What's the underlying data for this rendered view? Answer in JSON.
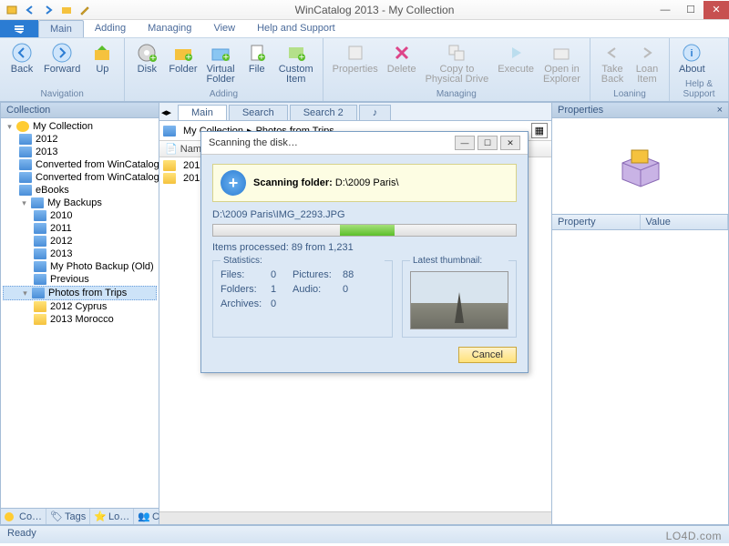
{
  "window": {
    "title": "WinCatalog 2013 - My Collection"
  },
  "tabs": {
    "main": "Main",
    "adding": "Adding",
    "managing": "Managing",
    "view": "View",
    "help": "Help and Support"
  },
  "ribbon": {
    "nav": {
      "back": "Back",
      "forward": "Forward",
      "up": "Up",
      "label": "Navigation"
    },
    "adding": {
      "disk": "Disk",
      "folder": "Folder",
      "virtual": "Virtual\nFolder",
      "file": "File",
      "custom": "Custom\nItem",
      "label": "Adding"
    },
    "managing": {
      "properties": "Properties",
      "delete": "Delete",
      "copy": "Copy to\nPhysical Drive",
      "execute": "Execute",
      "open": "Open in\nExplorer",
      "label": "Managing"
    },
    "loaning": {
      "take": "Take\nBack",
      "loan": "Loan\nItem",
      "label": "Loaning"
    },
    "helpg": {
      "about": "About",
      "label": "Help & Support"
    }
  },
  "sidebar": {
    "header": "Collection",
    "items": [
      {
        "label": "My Collection"
      },
      {
        "label": "2012"
      },
      {
        "label": "2013"
      },
      {
        "label": "Converted from WinCatalog"
      },
      {
        "label": "Converted from WinCatalog"
      },
      {
        "label": "eBooks"
      },
      {
        "label": "My Backups"
      },
      {
        "label": "2010"
      },
      {
        "label": "2011"
      },
      {
        "label": "2012"
      },
      {
        "label": "2013"
      },
      {
        "label": "My Photo Backup (Old)"
      },
      {
        "label": "Previous"
      },
      {
        "label": "Photos from Trips"
      },
      {
        "label": "2012 Cyprus"
      },
      {
        "label": "2013 Morocco"
      }
    ],
    "bottom_tabs": {
      "co1": "Co…",
      "tags": "Tags",
      "lo": "Lo…",
      "co2": "Co…"
    }
  },
  "center": {
    "tabs": {
      "main": "Main",
      "search": "Search",
      "search2": "Search 2"
    },
    "breadcrumb": {
      "a": "My Collection",
      "sep": "▸",
      "b": "Photos from Trips"
    },
    "col_name": "Name",
    "rows": [
      {
        "label": "2012"
      },
      {
        "label": "2013"
      }
    ]
  },
  "right": {
    "header": "Properties",
    "col_property": "Property",
    "col_value": "Value"
  },
  "dialog": {
    "title": "Scanning the disk…",
    "banner_prefix": "Scanning folder: ",
    "banner_path": "D:\\2009 Paris\\",
    "current_file": "D:\\2009 Paris\\IMG_2293.JPG",
    "items_line": "Items processed: 89 from 1,231",
    "stats_label": "Statistics:",
    "thumb_label": "Latest thumbnail:",
    "stats": {
      "files_l": "Files:",
      "files_v": "0",
      "pictures_l": "Pictures:",
      "pictures_v": "88",
      "folders_l": "Folders:",
      "folders_v": "1",
      "audio_l": "Audio:",
      "audio_v": "0",
      "archives_l": "Archives:",
      "archives_v": "0"
    },
    "cancel": "Cancel"
  },
  "status": "Ready",
  "watermark": "LO4D.com"
}
